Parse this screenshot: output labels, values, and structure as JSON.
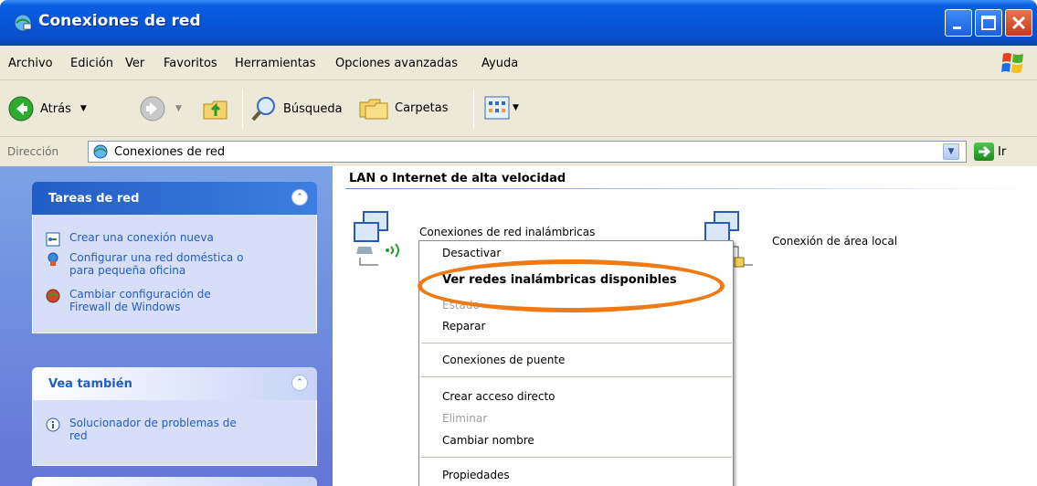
{
  "window": {
    "title": "Conexiones de red",
    "accent": "#0a5fe0",
    "close_color": "#c8391a"
  },
  "menubar": {
    "items": [
      "Archivo",
      "Edición",
      "Ver",
      "Favoritos",
      "Herramientas",
      "Opciones avanzadas",
      "Ayuda"
    ]
  },
  "toolbar": {
    "back_label": "Atrás",
    "search_label": "Búsqueda",
    "folders_label": "Carpetas"
  },
  "address": {
    "label": "Dirección",
    "value": "Conexiones de red",
    "go_label": "Ir"
  },
  "left_pane": {
    "network_tasks": {
      "title": "Tareas de red",
      "items": [
        {
          "label": "Crear una conexión nueva",
          "icon": "new-connection-icon"
        },
        {
          "label": "Configurar una red doméstica o para pequeña oficina",
          "icon": "home-network-icon"
        },
        {
          "label": "Cambiar configuración de Firewall de Windows",
          "icon": "firewall-icon"
        }
      ]
    },
    "see_also": {
      "title": "Vea también",
      "items": [
        {
          "label": "Solucionador de problemas de red",
          "icon": "info-icon"
        }
      ]
    }
  },
  "content": {
    "group_title": "LAN o Internet de alta velocidad",
    "connections": [
      {
        "label": "Conexiones de red inalámbricas",
        "icon": "wireless-connection-icon"
      },
      {
        "label": "Conexión de área local",
        "icon": "lan-connection-icon"
      }
    ]
  },
  "context_menu": {
    "items": [
      {
        "label": "Desactivar",
        "style": "normal"
      },
      {
        "label": "Ver redes inalámbricas disponibles",
        "style": "bold"
      },
      {
        "label": "Estado",
        "style": "disabled"
      },
      {
        "label": "Reparar",
        "style": "normal"
      },
      {
        "label": "Conexiones de puente",
        "style": "normal"
      },
      {
        "label": "Crear acceso directo",
        "style": "normal"
      },
      {
        "label": "Eliminar",
        "style": "disabled"
      },
      {
        "label": "Cambiar nombre",
        "style": "normal"
      },
      {
        "label": "Propiedades",
        "style": "normal"
      }
    ],
    "highlight_color": "#ef7a14"
  }
}
